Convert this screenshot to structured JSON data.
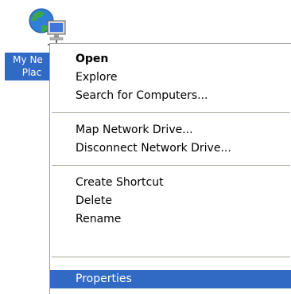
{
  "desktop_icon": {
    "label_line1": "My Ne",
    "label_line2": "Plac",
    "icon": "network-places-icon"
  },
  "context_menu": {
    "groups": [
      [
        "Open",
        "Explore",
        "Search for Computers..."
      ],
      [
        "Map Network Drive...",
        "Disconnect Network Drive..."
      ],
      [
        "Create Shortcut",
        "Delete",
        "Rename"
      ],
      [
        "Properties"
      ]
    ],
    "default_item": "Open",
    "selected_item": "Properties"
  },
  "colors": {
    "selection": "#316ac5",
    "menu_border": "#a0a0a0",
    "separator": "#aca899"
  }
}
